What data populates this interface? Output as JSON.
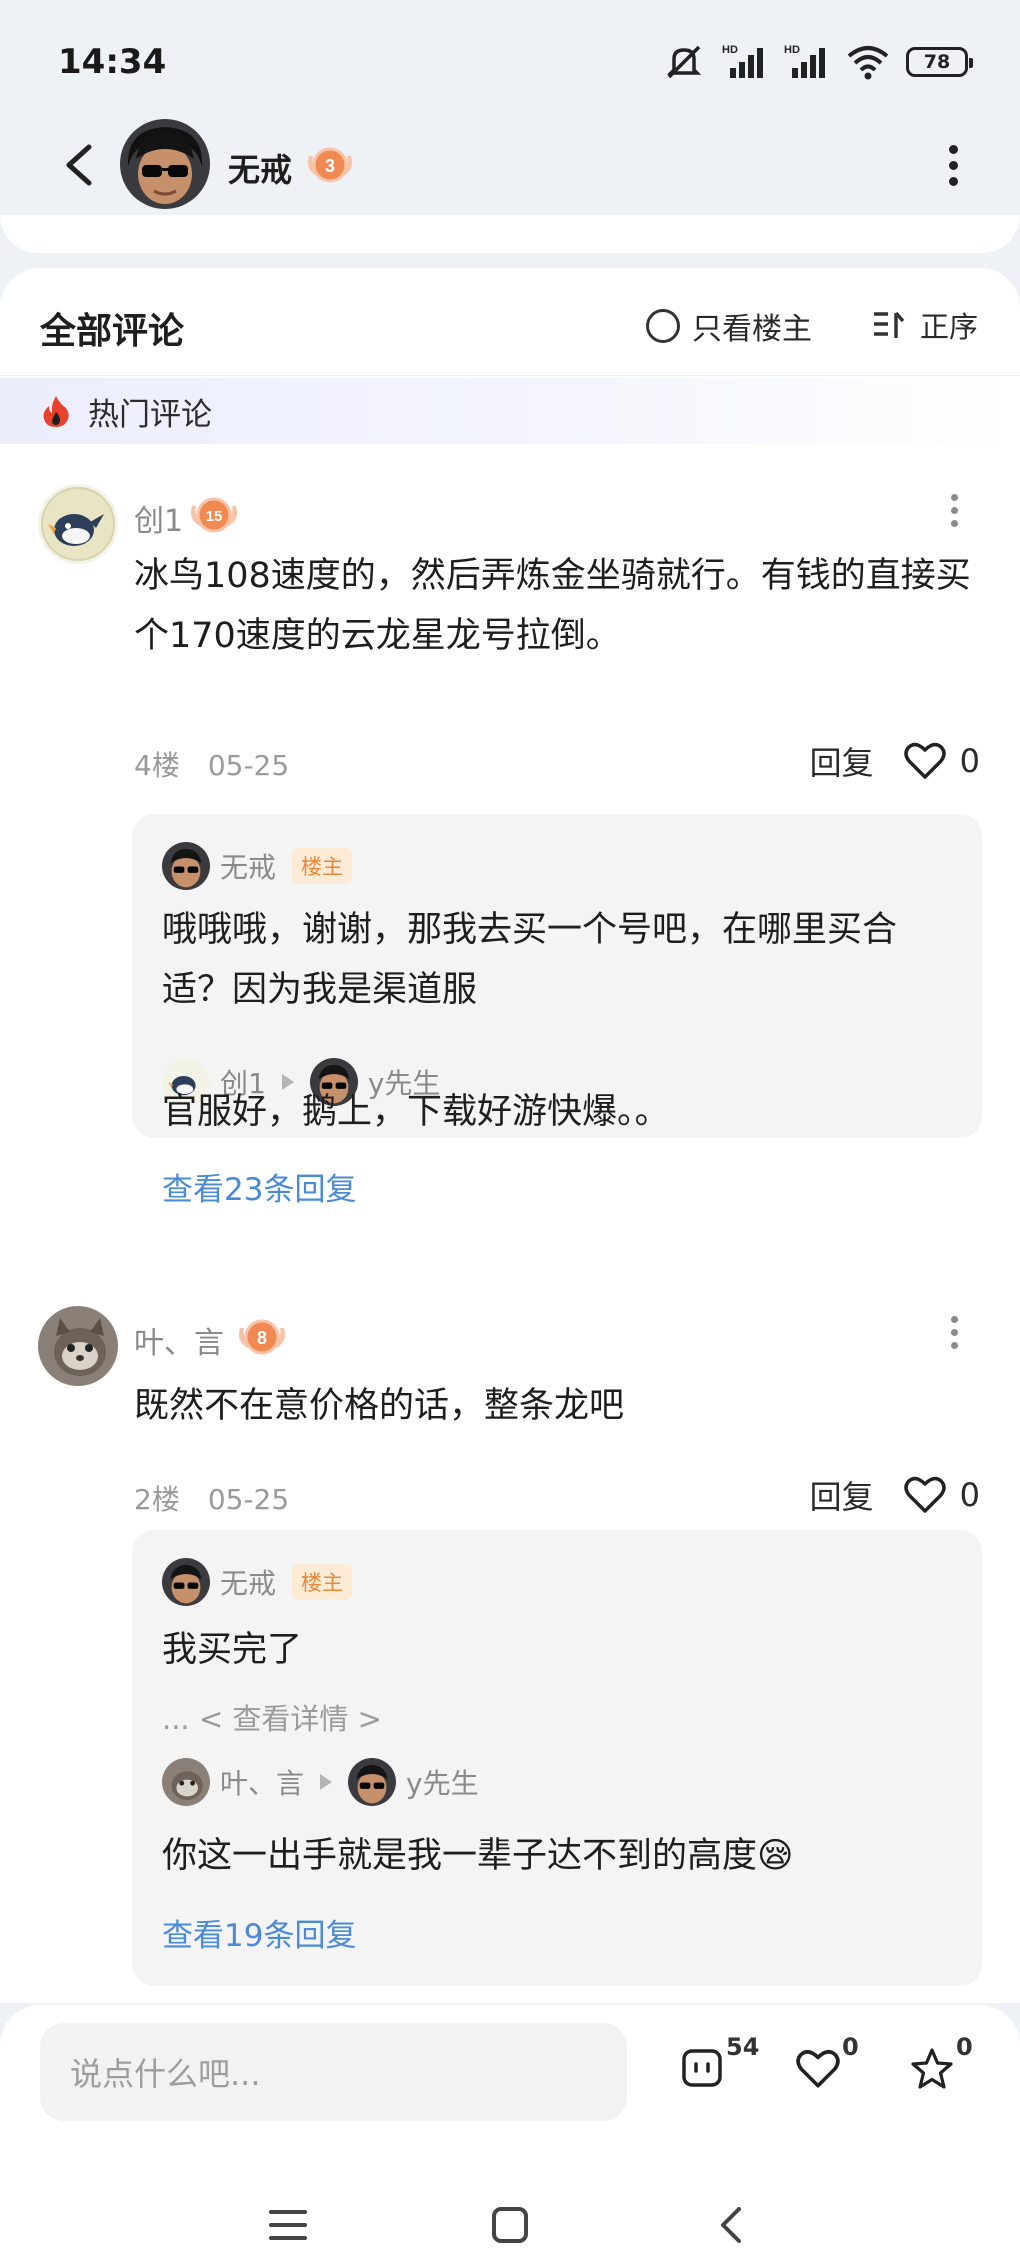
{
  "status_bar": {
    "time": "14:34",
    "battery": "78"
  },
  "header": {
    "username": "无戒",
    "level": "3"
  },
  "comments_header": {
    "title": "全部评论",
    "only_op_label": "只看楼主",
    "sort_label": "正序"
  },
  "hot_section": {
    "label": "热门评论"
  },
  "comments": [
    {
      "name": "创1",
      "level": "15",
      "text": "冰鸟108速度的，然后弄炼金坐骑就行。有钱的直接买个170速度的云龙星龙号拉倒。",
      "floor": "4楼",
      "date": "05-25",
      "reply_label": "回复",
      "likes": "0",
      "replies": {
        "first_name": "无戒",
        "op_tag": "楼主",
        "first_text": "哦哦哦，谢谢，那我去买一个号吧，在哪里买合适？因为我是渠道服",
        "second_from": "创1",
        "second_to": "y先生",
        "second_text": "官服好，鹅上，下载好游快爆。。",
        "view_more": "查看23条回复"
      }
    },
    {
      "name": "叶、言",
      "level": "8",
      "text": "既然不在意价格的话，整条龙吧",
      "floor": "2楼",
      "date": "05-25",
      "reply_label": "回复",
      "likes": "0",
      "replies": {
        "first_name": "无戒",
        "op_tag": "楼主",
        "first_text": "我买完了",
        "detail_link": "... < 查看详情 >",
        "second_from": "叶、言",
        "second_to": "y先生",
        "second_text": "你这一出手就是我一辈子达不到的高度😪",
        "view_more": "查看19条回复"
      }
    }
  ],
  "bottom_bar": {
    "input_placeholder": "说点什么吧...",
    "comment_count": "54",
    "like_count": "0",
    "favorite_count": "0"
  },
  "icons": [
    "back-arrow-icon",
    "more-vertical-icon",
    "sort-icon",
    "fire-icon",
    "heart-icon",
    "comment-icon",
    "star-icon",
    "menu-icon",
    "home-icon",
    "back-nav-icon"
  ],
  "colors": {
    "link": "#4a8bd8",
    "op_tag": "#e58a3c",
    "level_badge": "#f08a52",
    "hot_fire": "#e8412c"
  }
}
